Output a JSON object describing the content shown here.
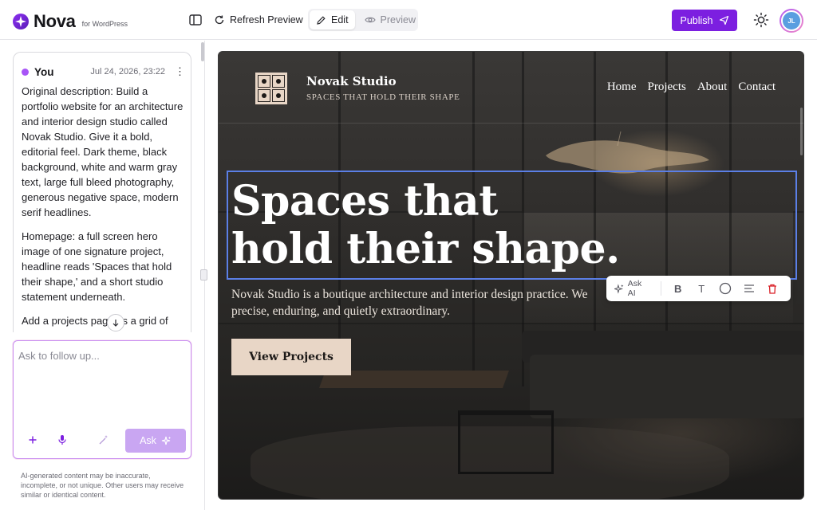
{
  "app": {
    "brand_name": "Nova",
    "brand_sub": "for WordPress",
    "accent": "#7c1fe0"
  },
  "toolbar": {
    "refresh_label": "Refresh Preview",
    "edit_label": "Edit",
    "preview_label": "Preview",
    "publish_label": "Publish",
    "avatar_initials": "JL",
    "icons": [
      "sidebar-toggle-icon",
      "refresh-icon",
      "pencil-icon",
      "eye-icon",
      "send-icon",
      "sun-icon"
    ]
  },
  "chat": {
    "user_name": "You",
    "timestamp": "Jul 24, 2026, 23:22",
    "paragraphs": [
      "Original description: Build a portfolio website for an architecture and interior design studio called Novak Studio. Give it a bold, editorial feel. Dark theme, black background, white and warm gray text, large full bleed photography, generous negative space, modern serif headlines.",
      "Homepage: a full screen hero image of one signature project, headline reads 'Spaces that hold their shape,' and a short studio statement underneath.",
      "Add a projects page as a grid of"
    ],
    "ask_placeholder": "Ask to follow up...",
    "ask_button": "Ask",
    "disclaimer": "AI-generated content may be inaccurate, incomplete, or not unique. Other users may receive similar or identical content."
  },
  "site": {
    "name": "Novak Studio",
    "tagline": "SPACES THAT HOLD THEIR SHAPE",
    "nav": [
      "Home",
      "Projects",
      "About",
      "Contact"
    ],
    "hero_title_line1": "Spaces that",
    "hero_title_line2": "hold their shape.",
    "hero_text_line1": "Novak Studio is a boutique architecture and interior design practice. We",
    "hero_text_line2": "precise, enduring, and quietly extraordinary.",
    "cta": "View Projects",
    "accent_sand": "#e8d6c6",
    "selection_color": "#5b7fe6"
  },
  "float_toolbar": {
    "ask_ai_label": "Ask AI",
    "tools": [
      "bold-icon",
      "text-icon",
      "circle-icon",
      "align-icon",
      "trash-icon"
    ],
    "bold_glyph": "B",
    "text_glyph": "T"
  }
}
